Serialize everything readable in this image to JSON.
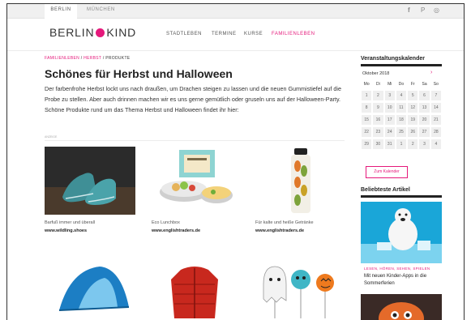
{
  "topbar": {
    "cities": [
      "BERLIN",
      "MÜNCHEN"
    ],
    "social_icons": [
      "facebook-icon",
      "pinterest-icon",
      "instagram-icon"
    ],
    "social_glyphs": [
      "f",
      "P",
      "◎"
    ]
  },
  "header": {
    "logo_left": "BERLIN",
    "logo_right": "KIND",
    "nav": [
      "STADTLEBEN",
      "TERMINE",
      "KURSE",
      "FAMILIENLEBEN"
    ],
    "active_nav": "FAMILIENLEBEN"
  },
  "breadcrumb": {
    "part1": "FAMILIENLEBEN",
    "part2": "HERBST",
    "current": "PRODUKTE",
    "sep": " / "
  },
  "article": {
    "title": "Schönes für Herbst und Halloween",
    "intro": "Der farbenfrohe Herbst lockt uns nach draußen, um Drachen steigen zu lassen und die neuen Gummistiefel auf die Probe zu stellen. Aber auch drinnen machen wir es uns gerne gemütlich oder gruseln uns auf der Halloween-Party. Schöne Produkte rund um das Thema Herbst und Halloween findet ihr hier:",
    "small_label": "ANZEIGE",
    "products": [
      {
        "caption": "Barfuß immer und überall",
        "link": "www.wildling.shoes"
      },
      {
        "caption": "Eco Lunchbox",
        "link": "www.englishtraders.de"
      },
      {
        "caption": "Für kalte und heiße Getränke",
        "link": "www.englishtraders.de"
      }
    ]
  },
  "sidebar": {
    "calendar_title": "Veranstaltungskalender",
    "month": "Oktober 2018",
    "next_arrow": "›",
    "weekdays": [
      "Mo",
      "Di",
      "Mi",
      "Do",
      "Fr",
      "Sa",
      "So"
    ],
    "days": [
      "1",
      "2",
      "3",
      "4",
      "5",
      "6",
      "7",
      "8",
      "9",
      "10",
      "11",
      "12",
      "13",
      "14",
      "15",
      "16",
      "17",
      "18",
      "19",
      "20",
      "21",
      "22",
      "23",
      "24",
      "25",
      "26",
      "27",
      "28",
      "29",
      "30",
      "31",
      "1",
      "2",
      "3",
      "4"
    ],
    "button": "Zum Kalender",
    "popular_title": "Beliebteste Artikel",
    "article_tag": "LESEN, HÖREN, SEHEN, SPIELEN",
    "article_title": "Mit neuen Kinder-Apps in die Sommerferien"
  },
  "colors": {
    "accent": "#e5197b",
    "text": "#222222"
  }
}
